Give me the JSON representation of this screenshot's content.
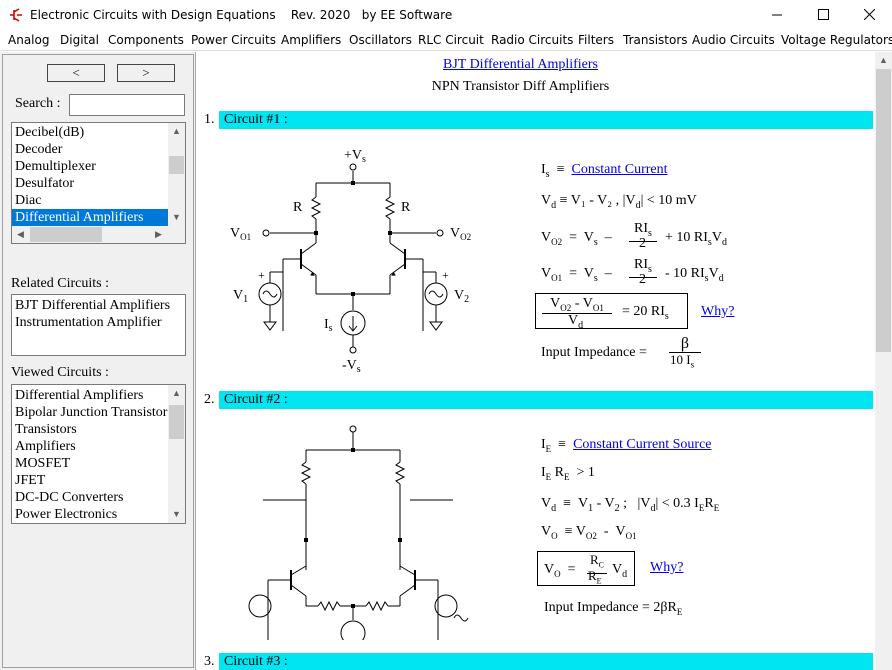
{
  "window": {
    "title": "Electronic Circuits with Design Equations    Rev. 2020   by EE Software"
  },
  "menu": [
    "Analog",
    "Digital",
    "Components",
    "Power Circuits",
    "Amplifiers",
    "Oscillators",
    "RLC Circuit",
    "Radio Circuits",
    "Filters",
    "Transistors",
    "Audio Circuits",
    "Voltage Regulators"
  ],
  "nav": {
    "prev": "<",
    "next": ">"
  },
  "search": {
    "label": "Search :",
    "value": ""
  },
  "topics": [
    "Decibel(dB)",
    "Decoder",
    "Demultiplexer",
    "Desulfator",
    "Diac",
    "Differential Amplifiers"
  ],
  "topics_selected": "Differential Amplifiers",
  "related": {
    "label": "Related Circuits :",
    "items": [
      "BJT Differential Amplifiers",
      "Instrumentation Amplifier"
    ]
  },
  "viewed": {
    "label": "Viewed Circuits :",
    "items": [
      "Differential Amplifiers",
      "Bipolar Junction Transistors",
      "Transistors",
      "Amplifiers",
      "MOSFET",
      "JFET",
      "DC-DC Converters",
      "Power Electronics"
    ]
  },
  "page": {
    "title_link": "BJT Differential Amplifiers",
    "subtitle": "NPN Transistor Diff Amplifiers"
  },
  "circuit1": {
    "num": "1.",
    "label": "Circuit #1 :",
    "labels": {
      "vplus": "+V",
      "s": "s",
      "vminus": "-V",
      "r": "R",
      "vo1": "V",
      "o1": "O1",
      "vo2": "V",
      "o2": "O2",
      "v1": "V",
      "one": "1",
      "v2": "V",
      "two": "2",
      "is": "I",
      "plus": "+"
    },
    "eq": {
      "is_lhs": "I",
      "is_sub": "s",
      "equiv": "≡",
      "is_link": "Constant Current",
      "vd_line": "≡  V₁ - V₂ ,     |V",
      "vd_tail": "|  <  10 mV",
      "vo2_tail": "+  10 RI",
      "vo1_tail": "-  10 RI",
      "ratio_rhs": "=  20 RI",
      "why": "Why?",
      "impedance": "Input Impedance  =",
      "beta": "β",
      "ten_is": "10 I"
    }
  },
  "circuit2": {
    "num": "2.",
    "label": "Circuit #2 :",
    "eq": {
      "ie_link": "Constant Current Source",
      "ie_re": "> 1",
      "vd_tail": "|  <  0.3 I",
      "vo_line": "≡  V",
      "why": "Why?",
      "impedance": "Input Impedance  =  2βR"
    }
  },
  "circuit3": {
    "num": "3.",
    "label": "Circuit #3 :"
  }
}
